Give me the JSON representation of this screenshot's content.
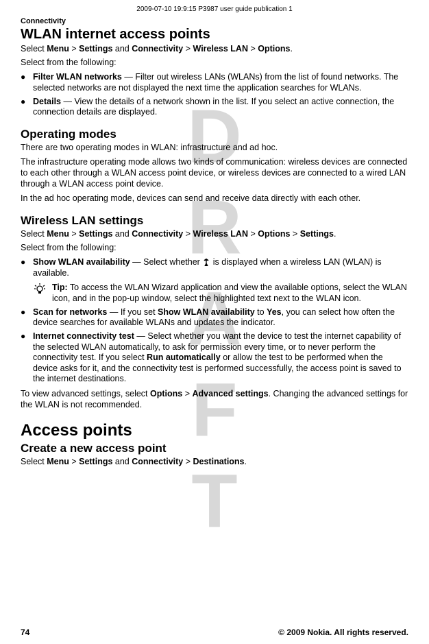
{
  "watermark": "DRAFT",
  "meta_header": "2009-07-10 19:9:15 P3987 user guide publication 1",
  "section_label": "Connectivity",
  "s1": {
    "heading": "WLAN internet access points",
    "select_word": "Select ",
    "nav_menu": "Menu",
    "nav_settings": "Settings",
    "nav_and": " and ",
    "nav_connectivity": "Connectivity",
    "nav_wlan": "Wireless LAN",
    "nav_options": "Options",
    "gt": " > ",
    "period": ".",
    "select_following": "Select from the following:",
    "b1_label": "Filter WLAN networks",
    "b1_text": " — Filter out wireless LANs (WLANs) from the list of found networks. The selected networks are not displayed the next time the application searches for WLANs.",
    "b2_label": "Details",
    "b2_text": " — View the details of a network shown in the list. If you select an active connection, the connection details are displayed."
  },
  "s2": {
    "heading": "Operating modes",
    "p1": "There are two operating modes in WLAN: infrastructure and ad hoc.",
    "p2": "The infrastructure operating mode allows two kinds of communication: wireless devices are connected to each other through a WLAN access point device, or wireless devices are connected to a wired LAN through a WLAN access point device.",
    "p3": "In the ad hoc operating mode, devices can send and receive data directly with each other."
  },
  "s3": {
    "heading": "Wireless LAN settings",
    "select_word": "Select ",
    "nav_menu": "Menu",
    "nav_settings": "Settings",
    "nav_and": " and ",
    "nav_connectivity": "Connectivity",
    "nav_wlan": "Wireless LAN",
    "nav_options": "Options",
    "nav_settings2": "Settings",
    "gt": " > ",
    "period": ".",
    "select_following": "Select from the following:",
    "b1_label": "Show WLAN availability",
    "b1_pre": " — Select whether ",
    "b1_post": " is displayed when a wireless LAN (WLAN) is available.",
    "tip_label": "Tip:",
    "tip_text": " To access the WLAN Wizard application and view the available options, select the WLAN icon, and in the pop-up window, select the highlighted text next to the WLAN icon.",
    "b2_label": "Scan for networks",
    "b2_pre": " — If you set ",
    "b2_bold1": "Show WLAN availability",
    "b2_mid": " to ",
    "b2_bold2": "Yes",
    "b2_post": ", you can select how often the device searches for available WLANs and updates the indicator.",
    "b3_label": "Internet connectivity test",
    "b3_pre": " — Select whether you want the device to test the internet capability of the selected WLAN automatically, to ask for permission every time, or to never perform the connectivity test. If you select ",
    "b3_bold": "Run automatically",
    "b3_post": " or allow the test to be performed when the device asks for it, and the connectivity test is performed successfully, the access point is saved to the internet destinations.",
    "adv_pre": "To view advanced settings, select ",
    "adv_options": "Options",
    "adv_gt": " > ",
    "adv_settings": "Advanced settings",
    "adv_post": ". Changing the advanced settings for the WLAN is not recommended."
  },
  "s4": {
    "heading": "Access points",
    "sub_heading": "Create a new access point",
    "select_word": "Select ",
    "nav_menu": "Menu",
    "nav_settings": "Settings",
    "nav_and": " and ",
    "nav_connectivity": "Connectivity",
    "nav_destinations": "Destinations",
    "gt": " > ",
    "period": "."
  },
  "footer": {
    "page": "74",
    "copyright": "© 2009 Nokia. All rights reserved."
  }
}
